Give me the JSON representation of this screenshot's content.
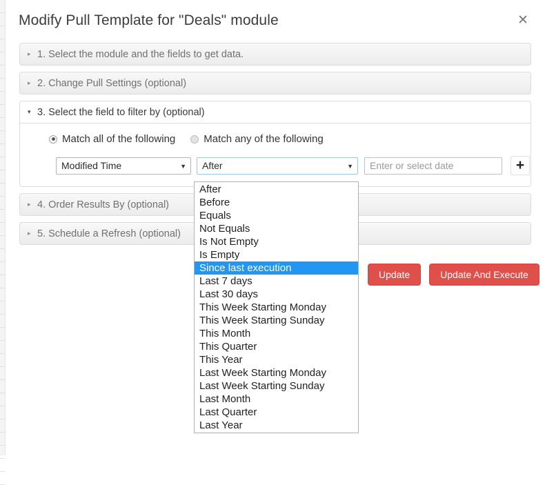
{
  "dialog": {
    "title": "Modify Pull Template for \"Deals\" module",
    "close_icon": "close-icon",
    "close_glyph": "✕"
  },
  "accordion": [
    {
      "number": "1.",
      "label": "1. Select the module and the fields to get data.",
      "expanded": false,
      "caret": "▸"
    },
    {
      "number": "2.",
      "label": "2. Change Pull Settings (optional)",
      "expanded": false,
      "caret": "▸"
    },
    {
      "number": "3.",
      "label": "3. Select the field to filter by (optional)",
      "expanded": true,
      "caret": "▾"
    },
    {
      "number": "4.",
      "label": "4. Order Results By (optional)",
      "expanded": false,
      "caret": "▸"
    },
    {
      "number": "5.",
      "label": "5. Schedule a Refresh (optional)",
      "expanded": false,
      "caret": "▸"
    }
  ],
  "filter_panel": {
    "match_options": [
      {
        "label": "Match all of the following",
        "checked": true
      },
      {
        "label": "Match any of the following",
        "checked": false
      }
    ],
    "field_select": {
      "value": "Modified Time",
      "arrow_glyph": "▼"
    },
    "operator_select": {
      "value": "After",
      "arrow_glyph": "▼",
      "focused": true,
      "open": true,
      "highlighted": "Since last execution",
      "options": [
        "After",
        "Before",
        "Equals",
        "Not Equals",
        "Is Not Empty",
        "Is Empty",
        "Since last execution",
        "Last 7 days",
        "Last 30 days",
        "This Week Starting Monday",
        "This Week Starting Sunday",
        "This Month",
        "This Quarter",
        "This Year",
        "Last Week Starting Monday",
        "Last Week Starting Sunday",
        "Last Month",
        "Last Quarter",
        "Last Year"
      ]
    },
    "date_input": {
      "value": "",
      "placeholder": "Enter or select date"
    },
    "add_button": {
      "label": "➕",
      "glyph": "+"
    }
  },
  "actions": {
    "update_label": "Update",
    "update_and_execute_label": "Update And Execute"
  },
  "colors": {
    "accent_red": "#e0504a",
    "highlight_blue": "#2196f3",
    "focus_border": "#a2c4e8",
    "panel_gray": "#ececec"
  }
}
